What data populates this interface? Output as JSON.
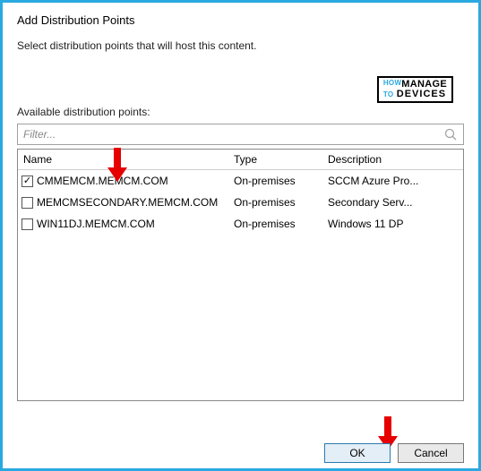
{
  "dialog": {
    "title": "Add Distribution Points",
    "subtitle": "Select distribution points that will host this content."
  },
  "filter": {
    "label": "Available distribution points:",
    "placeholder": "Filter..."
  },
  "columns": {
    "name": "Name",
    "type": "Type",
    "desc": "Description"
  },
  "rows": [
    {
      "checked": true,
      "name": "CMMEMCM.MEMCM.COM",
      "type": "On-premises",
      "desc": "SCCM Azure Pro..."
    },
    {
      "checked": false,
      "name": "MEMCMSECONDARY.MEMCM.COM",
      "type": "On-premises",
      "desc": "Secondary Serv..."
    },
    {
      "checked": false,
      "name": "WIN11DJ.MEMCM.COM",
      "type": "On-premises",
      "desc": "Windows 11 DP"
    }
  ],
  "buttons": {
    "ok": "OK",
    "cancel": "Cancel"
  },
  "watermark": {
    "how": "HOW",
    "to": "TO",
    "manage": "MANAGE",
    "devices": "DEVICES"
  }
}
